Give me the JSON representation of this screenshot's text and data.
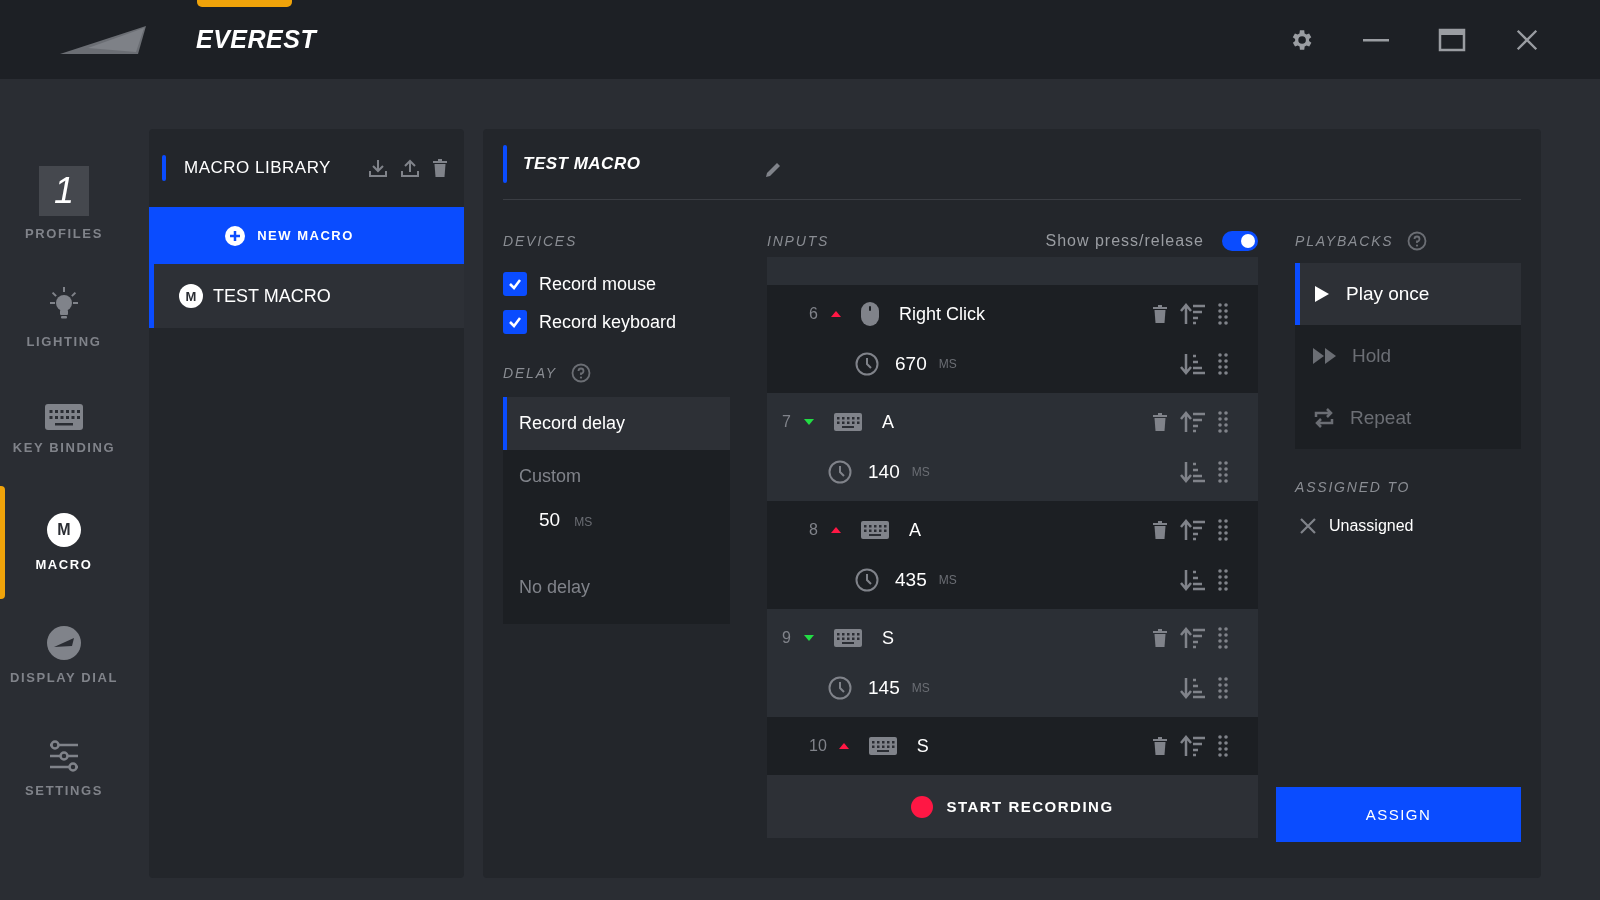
{
  "window": {
    "title": "EVEREST"
  },
  "nav": [
    {
      "kind": "profile",
      "label": "PROFILES",
      "badge": "1",
      "selected": false
    },
    {
      "kind": "lighting",
      "label": "LIGHTING",
      "selected": false
    },
    {
      "kind": "keyboard",
      "label": "KEY BINDING",
      "selected": false
    },
    {
      "kind": "macro",
      "label": "MACRO",
      "badge": "M",
      "selected": true
    },
    {
      "kind": "dial",
      "label": "DISPLAY DIAL",
      "selected": false
    },
    {
      "kind": "settings",
      "label": "SETTINGS",
      "selected": false
    }
  ],
  "library": {
    "title": "MACRO LIBRARY",
    "new_button": "NEW MACRO",
    "items": [
      {
        "badge": "M",
        "name": "TEST MACRO",
        "selected": true
      }
    ]
  },
  "editor": {
    "title": "TEST MACRO",
    "devices": {
      "heading": "DEVICES",
      "options": [
        {
          "label": "Record mouse",
          "checked": true
        },
        {
          "label": "Record keyboard",
          "checked": true
        }
      ]
    },
    "delay": {
      "heading": "DELAY",
      "options": [
        {
          "kind": "plain",
          "label": "Record delay",
          "selected": true
        },
        {
          "kind": "custom",
          "label": "Custom",
          "value": "50",
          "unit": "MS",
          "selected": false
        },
        {
          "kind": "plain",
          "label": "No delay",
          "selected": false
        }
      ]
    },
    "inputs": {
      "heading": "INPUTS",
      "toggle": {
        "label": "Show press/release",
        "on": true
      },
      "events": [
        {
          "index": "6",
          "released": true,
          "kind": "mouse",
          "key": "Right Click",
          "delay": "670",
          "unit": "MS"
        },
        {
          "index": "7",
          "released": false,
          "kind": "keyboard",
          "key": "A",
          "delay": "140",
          "unit": "MS"
        },
        {
          "index": "8",
          "released": true,
          "kind": "keyboard",
          "key": "A",
          "delay": "435",
          "unit": "MS"
        },
        {
          "index": "9",
          "released": false,
          "kind": "keyboard",
          "key": "S",
          "delay": "145",
          "unit": "MS"
        },
        {
          "index": "10",
          "released": true,
          "kind": "keyboard",
          "key": "S"
        }
      ],
      "record_button": "START RECORDING"
    },
    "playbacks": {
      "heading": "PLAYBACKS",
      "options": [
        {
          "kind": "once",
          "label": "Play once",
          "selected": true
        },
        {
          "kind": "hold",
          "label": "Hold",
          "selected": false
        },
        {
          "kind": "repeat",
          "label": "Repeat",
          "selected": false
        }
      ]
    },
    "assigned": {
      "heading": "ASSIGNED TO",
      "value": "Unassigned"
    },
    "assign_button": "ASSIGN"
  }
}
